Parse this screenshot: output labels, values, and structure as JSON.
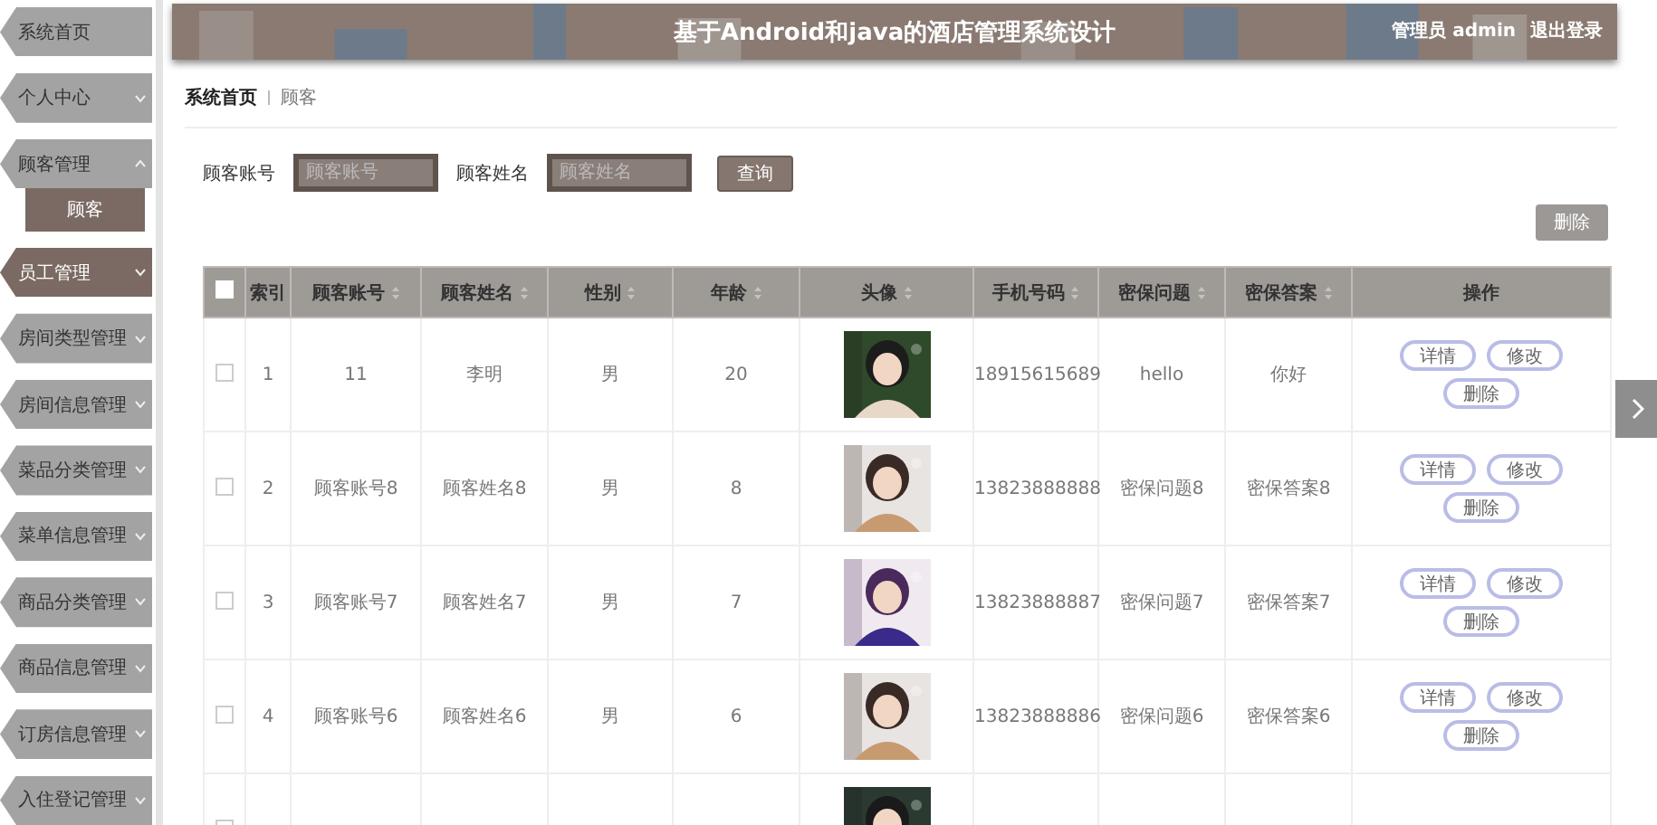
{
  "sidebar": {
    "items": [
      {
        "label": "系统首页",
        "kind": "link",
        "selected": false,
        "expanded": false
      },
      {
        "label": "个人中心",
        "kind": "menu",
        "selected": false,
        "expanded": false
      },
      {
        "label": "顾客管理",
        "kind": "menu",
        "selected": false,
        "expanded": true,
        "children": [
          {
            "label": "顾客",
            "selected": true
          }
        ]
      },
      {
        "label": "员工管理",
        "kind": "menu",
        "selected": true,
        "expanded": false
      },
      {
        "label": "房间类型管理",
        "kind": "menu",
        "selected": false,
        "expanded": false
      },
      {
        "label": "房间信息管理",
        "kind": "menu",
        "selected": false,
        "expanded": false
      },
      {
        "label": "菜品分类管理",
        "kind": "menu",
        "selected": false,
        "expanded": false
      },
      {
        "label": "菜单信息管理",
        "kind": "menu",
        "selected": false,
        "expanded": false
      },
      {
        "label": "商品分类管理",
        "kind": "menu",
        "selected": false,
        "expanded": false
      },
      {
        "label": "商品信息管理",
        "kind": "menu",
        "selected": false,
        "expanded": false
      },
      {
        "label": "订房信息管理",
        "kind": "menu",
        "selected": false,
        "expanded": false
      },
      {
        "label": "入住登记管理",
        "kind": "menu",
        "selected": false,
        "expanded": false
      }
    ]
  },
  "header": {
    "title": "基于Android和java的酒店管理系统设计",
    "user": "管理员 admin",
    "logout": "退出登录"
  },
  "breadcrumb": [
    "系统首页",
    "顾客"
  ],
  "search": {
    "fields": [
      {
        "label": "顾客账号",
        "placeholder": "顾客账号"
      },
      {
        "label": "顾客姓名",
        "placeholder": "顾客姓名"
      }
    ],
    "button": "查询"
  },
  "delete_button": "删除",
  "table": {
    "select_all_checked": false,
    "columns": [
      {
        "label": "索引",
        "sortable": false
      },
      {
        "label": "顾客账号",
        "sortable": true
      },
      {
        "label": "顾客姓名",
        "sortable": true
      },
      {
        "label": "性别",
        "sortable": true
      },
      {
        "label": "年龄",
        "sortable": true
      },
      {
        "label": "头像",
        "sortable": true
      },
      {
        "label": "手机号码",
        "sortable": true
      },
      {
        "label": "密保问题",
        "sortable": true
      },
      {
        "label": "密保答案",
        "sortable": true
      },
      {
        "label": "操作",
        "sortable": false
      }
    ],
    "rows": [
      {
        "checked": false,
        "cells": [
          "1",
          "11",
          "李明",
          "男",
          "20"
        ],
        "avatar": {
          "kind": "picture"
        },
        "tail": [
          "18915615689",
          "hello",
          "你好"
        ],
        "actions": [
          "详情",
          "修改",
          "删除"
        ]
      },
      {
        "checked": false,
        "cells": [
          "2",
          "顾客账号8",
          "顾客姓名8",
          "男",
          "8"
        ],
        "avatar": {
          "kind": "picture"
        },
        "tail": [
          "13823888888",
          "密保问题8",
          "密保答案8"
        ],
        "actions": [
          "详情",
          "修改",
          "删除"
        ]
      },
      {
        "checked": false,
        "cells": [
          "3",
          "顾客账号7",
          "顾客姓名7",
          "男",
          "7"
        ],
        "avatar": {
          "kind": "picture"
        },
        "tail": [
          "13823888887",
          "密保问题7",
          "密保答案7"
        ],
        "actions": [
          "详情",
          "修改",
          "删除"
        ]
      },
      {
        "checked": false,
        "cells": [
          "4",
          "顾客账号6",
          "顾客姓名6",
          "男",
          "6"
        ],
        "avatar": {
          "kind": "picture"
        },
        "tail": [
          "13823888886",
          "密保问题6",
          "密保答案6"
        ],
        "actions": [
          "详情",
          "修改",
          "删除"
        ]
      },
      {
        "checked": false,
        "cells": [],
        "avatar": {
          "kind": "picture"
        },
        "tail": [],
        "actions": []
      }
    ]
  }
}
